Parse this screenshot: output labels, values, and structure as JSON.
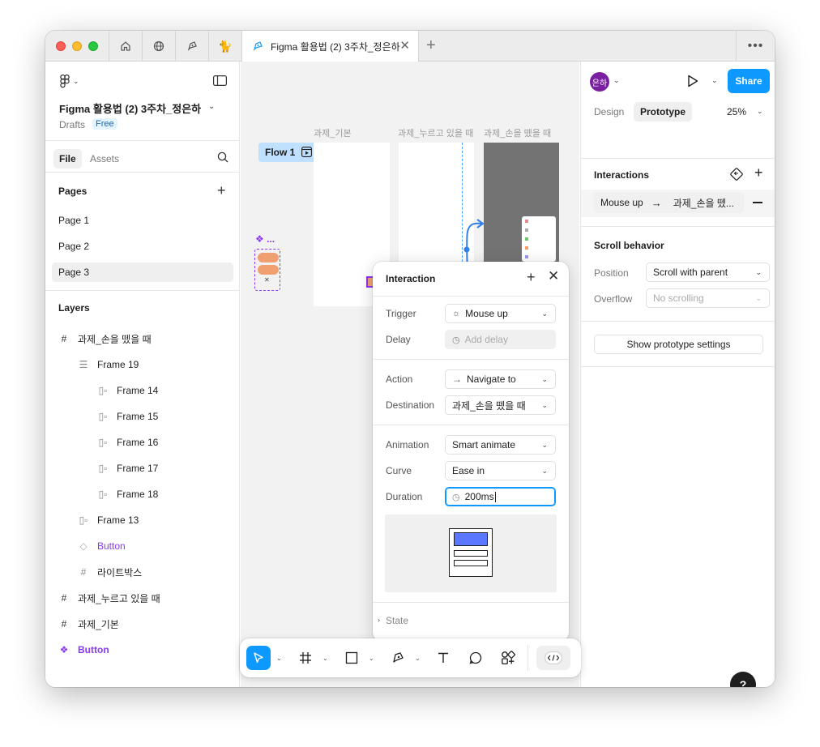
{
  "tabs": {
    "active_title": "Figma 활용법 (2) 3주차_정은하"
  },
  "file": {
    "title": "Figma 활용법 (2) 3주차_정은하",
    "location": "Drafts",
    "plan_badge": "Free"
  },
  "left_tabs": {
    "file": "File",
    "assets": "Assets"
  },
  "pages": {
    "title": "Pages",
    "items": [
      "Page 1",
      "Page 2",
      "Page 3"
    ],
    "selected": "Page 3"
  },
  "layers": {
    "title": "Layers",
    "items": [
      {
        "label": "과제_손을 뗐을 때",
        "icon": "frame-icon",
        "depth": 0
      },
      {
        "label": "Frame 19",
        "icon": "auto-layout-vertical-icon",
        "depth": 1
      },
      {
        "label": "Frame 14",
        "icon": "auto-layout-horizontal-icon",
        "depth": 2
      },
      {
        "label": "Frame 15",
        "icon": "auto-layout-horizontal-icon",
        "depth": 2
      },
      {
        "label": "Frame 16",
        "icon": "auto-layout-horizontal-icon",
        "depth": 2
      },
      {
        "label": "Frame 17",
        "icon": "auto-layout-horizontal-icon",
        "depth": 2
      },
      {
        "label": "Frame 18",
        "icon": "auto-layout-horizontal-icon",
        "depth": 2
      },
      {
        "label": "Frame 13",
        "icon": "auto-layout-horizontal-icon",
        "depth": 1
      },
      {
        "label": "Button",
        "icon": "instance-icon",
        "depth": 1,
        "purple": true
      },
      {
        "label": "라이트박스",
        "icon": "frame-icon",
        "depth": 1
      },
      {
        "label": "과제_누르고 있을 때",
        "icon": "frame-icon",
        "depth": 0
      },
      {
        "label": "과제_기본",
        "icon": "frame-icon",
        "depth": 0
      },
      {
        "label": "Button",
        "icon": "component-icon",
        "depth": 0,
        "purple": true
      }
    ]
  },
  "canvas": {
    "frame_labels": [
      "과제_기본",
      "과제_누르고 있을 때",
      "과제_손을 뗐을 때"
    ],
    "flow_label": "Flow 1",
    "component_label": "❖ ..."
  },
  "interaction_popover": {
    "title": "Interaction",
    "trigger_label": "Trigger",
    "trigger_value": "Mouse up",
    "delay_label": "Delay",
    "delay_placeholder": "Add delay",
    "action_label": "Action",
    "action_value": "Navigate to",
    "destination_label": "Destination",
    "destination_value": "과제_손을 뗐을 때",
    "animation_label": "Animation",
    "animation_value": "Smart animate",
    "curve_label": "Curve",
    "curve_value": "Ease in",
    "duration_label": "Duration",
    "duration_value": "200ms",
    "state_label": "State"
  },
  "right_panel": {
    "avatar_text": "은하",
    "share_label": "Share",
    "design_tab": "Design",
    "prototype_tab": "Prototype",
    "zoom": "25%",
    "interactions_title": "Interactions",
    "interaction_trigger": "Mouse up",
    "interaction_destination": "과제_손을 뗐...",
    "scroll_title": "Scroll behavior",
    "position_label": "Position",
    "position_value": "Scroll with parent",
    "overflow_label": "Overflow",
    "overflow_value": "No scrolling",
    "prototype_settings_label": "Show prototype settings",
    "help_label": "?"
  },
  "colors": {
    "accent": "#0d99ff",
    "component": "#8a38f5",
    "flow_chip": "#bfe1ff",
    "avatar": "#7a1fa2"
  }
}
